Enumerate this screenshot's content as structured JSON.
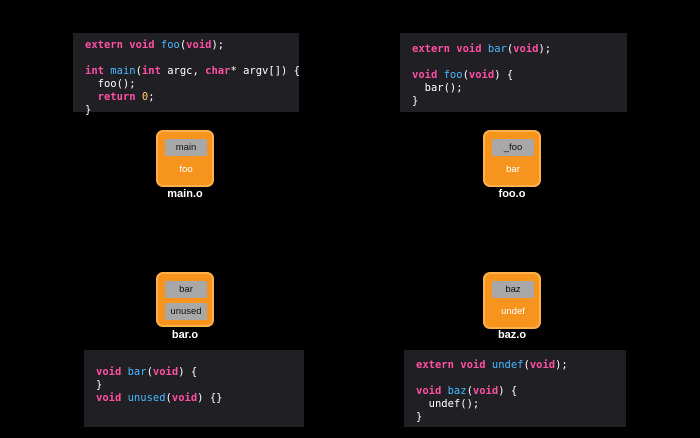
{
  "panels": {
    "main_c": {
      "lines": [
        [
          {
            "t": "extern ",
            "c": "kw"
          },
          {
            "t": "void ",
            "c": "kw"
          },
          {
            "t": "foo",
            "c": "fn"
          },
          {
            "t": "(",
            "c": ""
          },
          {
            "t": "void",
            "c": "kw"
          },
          {
            "t": ");",
            "c": ""
          }
        ],
        [],
        [
          {
            "t": "int ",
            "c": "kw"
          },
          {
            "t": "main",
            "c": "fn"
          },
          {
            "t": "(",
            "c": ""
          },
          {
            "t": "int ",
            "c": "kw"
          },
          {
            "t": "argc, ",
            "c": ""
          },
          {
            "t": "char",
            "c": "kw"
          },
          {
            "t": "* argv[]) {",
            "c": ""
          }
        ],
        [
          {
            "t": "  foo();",
            "c": ""
          }
        ],
        [
          {
            "t": "  ",
            "c": ""
          },
          {
            "t": "return ",
            "c": "kw"
          },
          {
            "t": "0",
            "c": "num"
          },
          {
            "t": ";",
            "c": ""
          }
        ],
        [
          {
            "t": "}",
            "c": ""
          }
        ]
      ]
    },
    "foo_c": {
      "lines": [
        [
          {
            "t": "extern ",
            "c": "kw"
          },
          {
            "t": "void ",
            "c": "kw"
          },
          {
            "t": "bar",
            "c": "fn"
          },
          {
            "t": "(",
            "c": ""
          },
          {
            "t": "void",
            "c": "kw"
          },
          {
            "t": ");",
            "c": ""
          }
        ],
        [],
        [
          {
            "t": "void ",
            "c": "kw"
          },
          {
            "t": "foo",
            "c": "fn"
          },
          {
            "t": "(",
            "c": ""
          },
          {
            "t": "void",
            "c": "kw"
          },
          {
            "t": ") {",
            "c": ""
          }
        ],
        [
          {
            "t": "  bar();",
            "c": ""
          }
        ],
        [
          {
            "t": "}",
            "c": ""
          }
        ]
      ]
    },
    "bar_c": {
      "lines": [
        [
          {
            "t": "void ",
            "c": "kw"
          },
          {
            "t": "bar",
            "c": "fn"
          },
          {
            "t": "(",
            "c": ""
          },
          {
            "t": "void",
            "c": "kw"
          },
          {
            "t": ") {",
            "c": ""
          }
        ],
        [
          {
            "t": "}",
            "c": ""
          }
        ],
        [
          {
            "t": "void ",
            "c": "kw"
          },
          {
            "t": "unused",
            "c": "fn"
          },
          {
            "t": "(",
            "c": ""
          },
          {
            "t": "void",
            "c": "kw"
          },
          {
            "t": ") {}",
            "c": ""
          }
        ]
      ]
    },
    "baz_c": {
      "lines": [
        [
          {
            "t": "extern ",
            "c": "kw"
          },
          {
            "t": "void ",
            "c": "kw"
          },
          {
            "t": "undef",
            "c": "fn"
          },
          {
            "t": "(",
            "c": ""
          },
          {
            "t": "void",
            "c": "kw"
          },
          {
            "t": ");",
            "c": ""
          }
        ],
        [],
        [
          {
            "t": "void ",
            "c": "kw"
          },
          {
            "t": "baz",
            "c": "fn"
          },
          {
            "t": "(",
            "c": ""
          },
          {
            "t": "void",
            "c": "kw"
          },
          {
            "t": ") {",
            "c": ""
          }
        ],
        [
          {
            "t": "  undef();",
            "c": ""
          }
        ],
        [
          {
            "t": "}",
            "c": ""
          }
        ]
      ]
    }
  },
  "objects": {
    "main_o": {
      "label": "main.o",
      "defined": [
        "main"
      ],
      "undefined": [
        "foo"
      ]
    },
    "foo_o": {
      "label": "foo.o",
      "defined": [
        "_foo"
      ],
      "undefined": [
        "bar"
      ]
    },
    "bar_o": {
      "label": "bar.o",
      "defined": [
        "bar",
        "unused"
      ],
      "undefined": []
    },
    "baz_o": {
      "label": "baz.o",
      "defined": [
        "baz"
      ],
      "undefined": [
        "undef"
      ]
    }
  },
  "colors": {
    "keyword": "#ff4fa3",
    "function": "#49b8ff",
    "number": "#ffd166",
    "object": "#f7941d",
    "symbol": "#a8a8a8",
    "panel": "#1f1f24"
  }
}
